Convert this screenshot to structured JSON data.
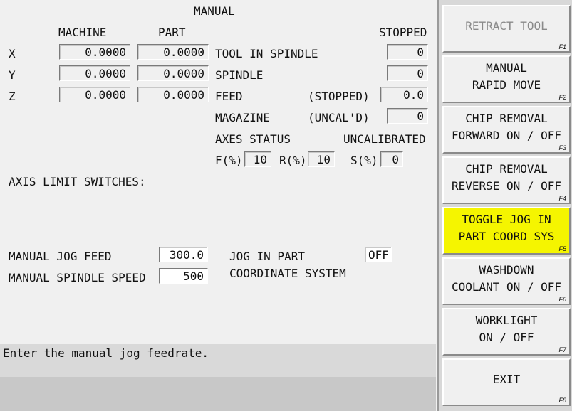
{
  "title": "MANUAL",
  "columns": {
    "machine": "MACHINE",
    "part": "PART",
    "state": "STOPPED"
  },
  "axes": [
    {
      "label": "X",
      "machine": "0.0000",
      "part": "0.0000"
    },
    {
      "label": "Y",
      "machine": "0.0000",
      "part": "0.0000"
    },
    {
      "label": "Z",
      "machine": "0.0000",
      "part": "0.0000"
    }
  ],
  "status": {
    "tool_in_spindle": {
      "label": "TOOL IN SPINDLE",
      "value": "0"
    },
    "spindle": {
      "label": "SPINDLE",
      "value": "0"
    },
    "feed": {
      "label": "FEED",
      "note": "(STOPPED)",
      "value": "0.0"
    },
    "magazine": {
      "label": "MAGAZINE",
      "note": "(UNCAL'D)",
      "value": "0"
    },
    "axes_status": {
      "label": "AXES STATUS",
      "value": "UNCALIBRATED"
    },
    "overrides": [
      {
        "label": "F(%)",
        "value": "10"
      },
      {
        "label": "R(%)",
        "value": "10"
      },
      {
        "label": "S(%)",
        "value": "0"
      }
    ]
  },
  "axis_limit_label": "AXIS LIMIT SWITCHES:",
  "jog_feed": {
    "label": "MANUAL JOG FEED",
    "value": "300.0"
  },
  "spindle_speed": {
    "label": "MANUAL SPINDLE SPEED",
    "value": "500"
  },
  "jog_part": {
    "label_line1": "JOG IN PART",
    "label_line2": "COORDINATE SYSTEM",
    "value": "OFF"
  },
  "status_message": "Enter the manual jog feedrate.",
  "function_keys": [
    {
      "label": "RETRACT TOOL",
      "key": "F1",
      "state": "disabled"
    },
    {
      "label": "MANUAL\nRAPID MOVE",
      "key": "F2",
      "state": "normal"
    },
    {
      "label": "CHIP REMOVAL\nFORWARD ON / OFF",
      "key": "F3",
      "state": "normal"
    },
    {
      "label": "CHIP REMOVAL\nREVERSE ON / OFF",
      "key": "F4",
      "state": "normal"
    },
    {
      "label": "TOGGLE JOG IN\nPART COORD SYS",
      "key": "F5",
      "state": "highlighted"
    },
    {
      "label": "WASHDOWN\nCOOLANT ON / OFF",
      "key": "F6",
      "state": "normal"
    },
    {
      "label": "WORKLIGHT\nON / OFF",
      "key": "F7",
      "state": "normal"
    },
    {
      "label": "EXIT",
      "key": "F8",
      "state": "normal"
    }
  ],
  "colors": {
    "highlight": "#f5f500",
    "background": "#f0f0f0",
    "disabled_text": "#8a8a8a"
  }
}
